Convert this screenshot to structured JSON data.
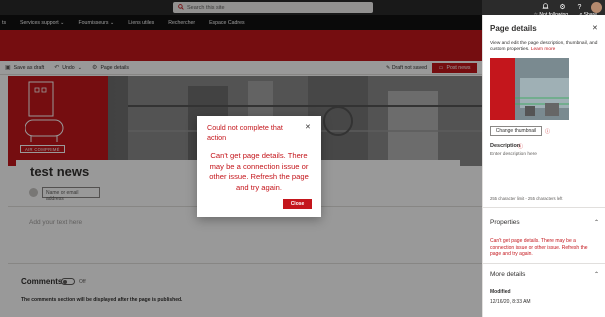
{
  "search": {
    "placeholder": "Search this site"
  },
  "suitebar": {
    "settings_icon": "gear-icon",
    "help_icon": "help-icon"
  },
  "nav": {
    "items": [
      "ts",
      "Services support",
      "Fournisseurs",
      "Liens utiles",
      "Rechercher",
      "Espace Cadres"
    ]
  },
  "header": {
    "not_following": "Not following",
    "share": "Share"
  },
  "commandbar": {
    "save_as_draft": "Save as draft",
    "undo": "Undo",
    "page_details": "Page details",
    "draft_status": "Draft not saved",
    "post_news": "Post news"
  },
  "hero": {
    "tag": "AIR COMPRIMÉ"
  },
  "page": {
    "title": "test news",
    "author_placeholder": "Name or email address",
    "text_placeholder": "Add your text here"
  },
  "comments": {
    "title": "Comments",
    "toggle_state": "Off",
    "note": "The comments section will be displayed after the page is published."
  },
  "dialog": {
    "title": "Could not complete that action",
    "message": "Can't get page details. There may be a connection issue or other issue. Refresh the page and try again.",
    "close_label": "Close"
  },
  "panel": {
    "title": "Page details",
    "description": "View and edit the page description, thumbnail, and custom properties.",
    "learn_more": "Learn more",
    "change_thumbnail": "Change thumbnail",
    "description_label": "Description",
    "description_placeholder": "Enter description here",
    "char_limit": "255 character limit - 255 characters left",
    "properties_title": "Properties",
    "properties_error": "Can't get page details. There may be a connection issue or other issue. Refresh the page and try again.",
    "more_details_title": "More details",
    "modified_label": "Modified",
    "modified_value": "12/16/20, 8:33 AM"
  },
  "colors": {
    "brand": "#c4161c",
    "suitebar": "#2b2b2b",
    "navbar": "#111111"
  }
}
